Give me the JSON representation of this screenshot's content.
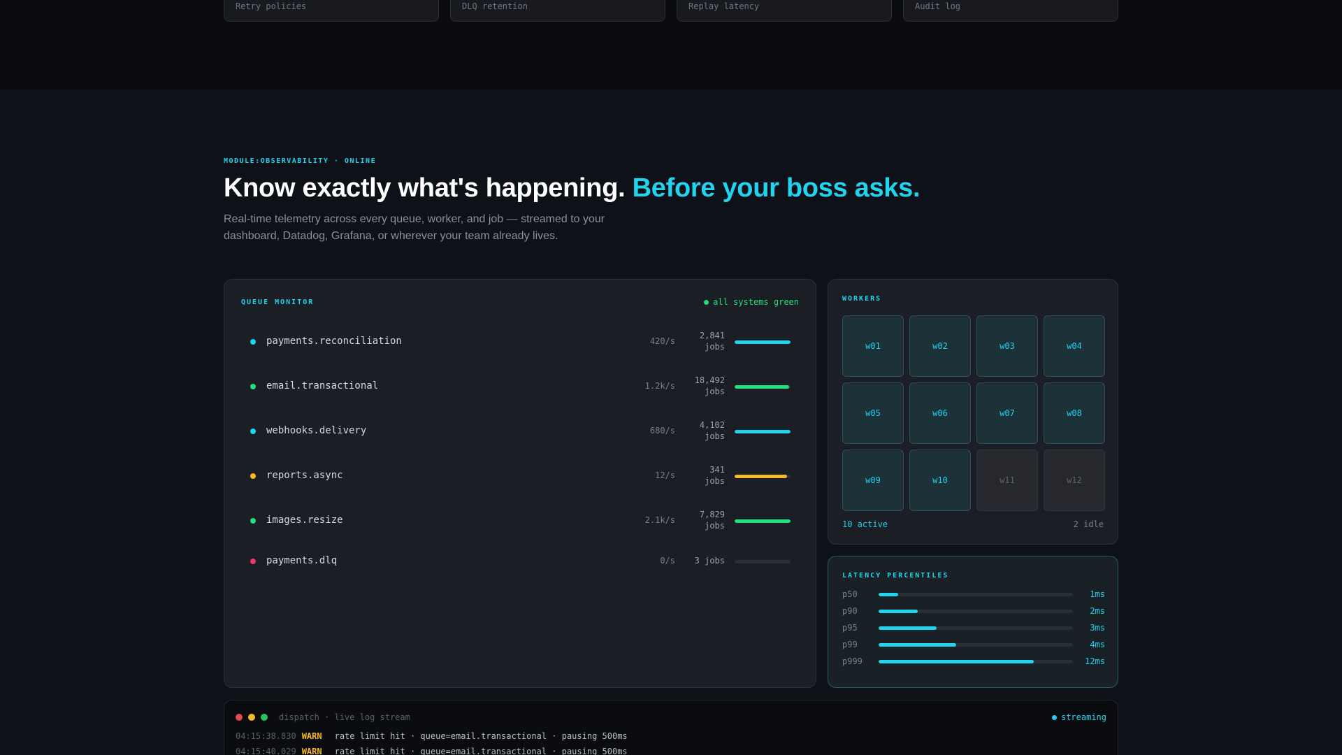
{
  "top_cards": [
    {
      "label": "Retry policies"
    },
    {
      "label": "DLQ retention"
    },
    {
      "label": "Replay latency"
    },
    {
      "label": "Audit log"
    }
  ],
  "section": {
    "eyebrow": "MODULE:OBSERVABILITY · ONLINE",
    "headline_main": "Know exactly what's happening.",
    "headline_accent": "Before your boss asks.",
    "subtext": "Real-time telemetry across every queue, worker, and job — streamed to your dashboard, Datadog, Grafana, or wherever your team already lives."
  },
  "queue_monitor": {
    "label": "QUEUE MONITOR",
    "status": "all systems green",
    "queues": [
      {
        "name": "payments.reconciliation",
        "rate": "420/s",
        "jobs_count": "2,841",
        "jobs_unit": "jobs",
        "load": 1.0,
        "color": "#22d3ee"
      },
      {
        "name": "email.transactional",
        "rate": "1.2k/s",
        "jobs_count": "18,492",
        "jobs_unit": "jobs",
        "load": 0.97,
        "color": "#22e07a"
      },
      {
        "name": "webhooks.delivery",
        "rate": "680/s",
        "jobs_count": "4,102",
        "jobs_unit": "jobs",
        "load": 1.0,
        "color": "#22d3ee"
      },
      {
        "name": "reports.async",
        "rate": "12/s",
        "jobs_count": "341",
        "jobs_unit": "jobs",
        "load": 0.94,
        "color": "#f5b92a"
      },
      {
        "name": "images.resize",
        "rate": "2.1k/s",
        "jobs_count": "7,829",
        "jobs_unit": "jobs",
        "load": 1.0,
        "color": "#22e07a"
      },
      {
        "name": "payments.dlq",
        "rate": "0/s",
        "jobs_count": "3 jobs",
        "jobs_unit": "",
        "load": 0.0,
        "color": "#f0346e"
      }
    ]
  },
  "workers": {
    "label": "WORKERS",
    "items": [
      {
        "id": "w01",
        "state": "active"
      },
      {
        "id": "w02",
        "state": "active"
      },
      {
        "id": "w03",
        "state": "active"
      },
      {
        "id": "w04",
        "state": "active"
      },
      {
        "id": "w05",
        "state": "active"
      },
      {
        "id": "w06",
        "state": "active"
      },
      {
        "id": "w07",
        "state": "active"
      },
      {
        "id": "w08",
        "state": "active"
      },
      {
        "id": "w09",
        "state": "active"
      },
      {
        "id": "w10",
        "state": "active"
      },
      {
        "id": "w11",
        "state": "idle"
      },
      {
        "id": "w12",
        "state": "idle"
      }
    ],
    "active_text": "10 active",
    "idle_text": "2 idle"
  },
  "latency": {
    "label": "LATENCY PERCENTILES",
    "rows": [
      {
        "name": "p50",
        "value": "1ms",
        "level": 0.1
      },
      {
        "name": "p90",
        "value": "2ms",
        "level": 0.2
      },
      {
        "name": "p95",
        "value": "3ms",
        "level": 0.3
      },
      {
        "name": "p99",
        "value": "4ms",
        "level": 0.4
      },
      {
        "name": "p999",
        "value": "12ms",
        "level": 0.8
      }
    ]
  },
  "log": {
    "title": "dispatch · live log stream",
    "status": "streaming",
    "lines": [
      {
        "time": "04:15:38.830",
        "level": "WARN",
        "message": "rate limit hit · queue=email.transactional · pausing 500ms"
      },
      {
        "time": "04:15:40.029",
        "level": "WARN",
        "message": "rate limit hit · queue=email.transactional · pausing 500ms"
      }
    ]
  },
  "colors": {
    "accent": "#22d3ee",
    "green": "#22e07a",
    "amber": "#f5b92a",
    "red": "#f0346e"
  }
}
